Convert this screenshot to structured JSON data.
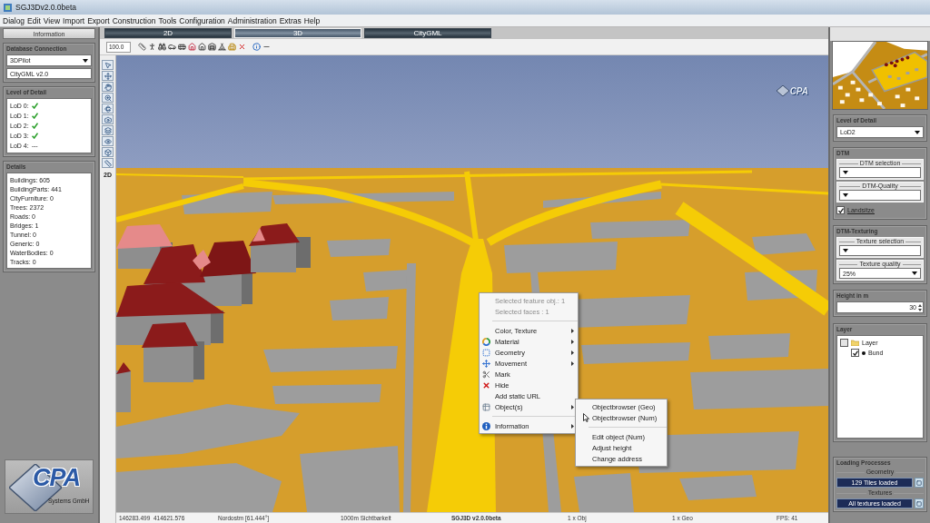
{
  "window": {
    "title": "SGJ3Dv2.0.0beta"
  },
  "menu_bar": [
    "Dialog",
    "Edit",
    "View",
    "Import",
    "Export",
    "Construction",
    "Tools",
    "Configuration",
    "Administration",
    "Extras",
    "Help"
  ],
  "left_panel": {
    "tab": "Information",
    "database_connection": {
      "title": "Database Connection",
      "database": "3DPilot",
      "format": "CityGML v2.0"
    },
    "level_of_detail": {
      "title": "Level of Detail",
      "items": [
        {
          "label": "LoD 0:",
          "available": true
        },
        {
          "label": "LoD 1:",
          "available": true
        },
        {
          "label": "LoD 2:",
          "available": true
        },
        {
          "label": "LoD 3:",
          "available": true
        },
        {
          "label": "LoD 4:",
          "available": false,
          "value": "---"
        }
      ]
    },
    "details": {
      "title": "Details",
      "items": [
        "Buildings: 605",
        "BuildingParts: 441",
        "CityFurniture: 0",
        "Trees: 2372",
        "Roads: 0",
        "Bridges: 1",
        "Tunnel: 0",
        "Generic: 0",
        "WaterBodies: 0",
        "Tracks: 0"
      ]
    },
    "logo": {
      "title": "CPA",
      "subtitle": "Systems GmbH"
    }
  },
  "view_tabs": [
    {
      "label": "2D",
      "selected": false
    },
    {
      "label": "3D",
      "selected": true
    },
    {
      "label": "CityGML",
      "selected": false
    }
  ],
  "toolbar": {
    "scale": "100.0"
  },
  "side_toolbar": {
    "view_toggle": "2D"
  },
  "scene": {
    "logo": "CPA",
    "context_menu": {
      "items": [
        {
          "kind": "item",
          "label": "Selected feature obj.: 1",
          "disabled": true,
          "submenu": false
        },
        {
          "kind": "item",
          "label": "Selected faces : 1",
          "disabled": true,
          "submenu": false
        },
        {
          "kind": "separator"
        },
        {
          "kind": "item",
          "label": "Color, Texture",
          "disabled": false,
          "submenu": true
        },
        {
          "kind": "item",
          "label": "Material",
          "disabled": false,
          "submenu": true
        },
        {
          "kind": "item",
          "label": "Geometry",
          "disabled": false,
          "submenu": true
        },
        {
          "kind": "item",
          "label": "Movement",
          "disabled": false,
          "submenu": true
        },
        {
          "kind": "item",
          "label": "Mark",
          "disabled": false,
          "submenu": false
        },
        {
          "kind": "item",
          "label": "Hide",
          "disabled": false,
          "submenu": false
        },
        {
          "kind": "item",
          "label": "Add static URL",
          "disabled": false,
          "submenu": false
        },
        {
          "kind": "item",
          "label": "Object(s)",
          "disabled": false,
          "submenu": true,
          "children": [
            {
              "kind": "item",
              "label": "Objectbrowser (Geo)"
            },
            {
              "kind": "item",
              "label": "Objectbrowser (Num)"
            },
            {
              "kind": "separator"
            },
            {
              "kind": "item",
              "label": "Edit object (Num)"
            },
            {
              "kind": "item",
              "label": "Adjust height"
            },
            {
              "kind": "item",
              "label": "Change address"
            }
          ]
        },
        {
          "kind": "separator"
        },
        {
          "kind": "item",
          "label": "Information",
          "disabled": false,
          "submenu": true
        }
      ]
    }
  },
  "status_bar": [
    {
      "text": "146283.499  414621.576",
      "bold": false
    },
    {
      "text": "Nordostm [61.444°]",
      "bold": false
    },
    {
      "text": "1000m Sichtbarkeit",
      "bold": false
    },
    {
      "text": "SGJ3D v2.0.0beta",
      "bold": true
    },
    {
      "text": "1 x Obj",
      "bold": false
    },
    {
      "text": "1 x Geo",
      "bold": false
    },
    {
      "text": "FPS: 41",
      "bold": false
    }
  ],
  "right_panel": {
    "level_of_detail": {
      "title": "Level of Detail",
      "value": "LoD2"
    },
    "dtm": {
      "title": "DTM",
      "selection": {
        "label": "DTM selection"
      },
      "quality": {
        "label": "DTM-Quality"
      },
      "option": {
        "label": "Landsitze",
        "checked": true
      }
    },
    "dtm_texturing": {
      "title": "DTM-Texturing",
      "selection": {
        "label": "Texture selection"
      },
      "quality": {
        "label": "Texture quality",
        "value": "25%"
      }
    },
    "height": {
      "title": "Height in m",
      "value": "30"
    },
    "layer": {
      "title": "Layer",
      "tree": [
        {
          "label": "Layer",
          "checked": false,
          "children": [
            {
              "label": "Bund",
              "checked": true
            }
          ]
        }
      ]
    },
    "loading": {
      "title": "Loading Processes",
      "bars": [
        {
          "label": "Geometry",
          "status": "129 Tiles loaded"
        },
        {
          "label": "Textures",
          "status": "All textures loaded"
        }
      ]
    }
  }
}
